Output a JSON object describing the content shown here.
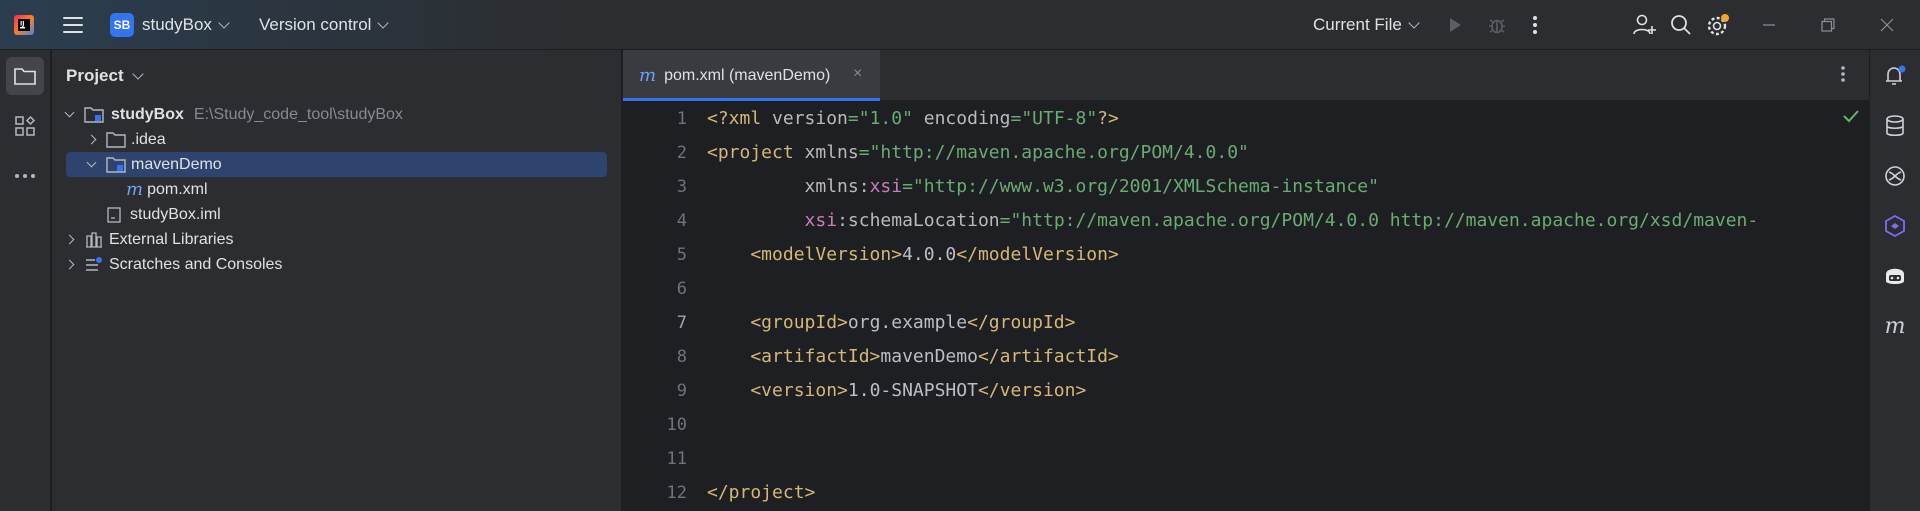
{
  "titlebar": {
    "project_badge": "SB",
    "project_name": "studyBox",
    "vcs_label": "Version control",
    "run_config": "Current File"
  },
  "project_panel": {
    "title": "Project",
    "tree": [
      {
        "label": "studyBox",
        "path": "E:\\Study_code_tool\\studyBox"
      },
      {
        "label": ".idea"
      },
      {
        "label": "mavenDemo"
      },
      {
        "label": "pom.xml"
      },
      {
        "label": "studyBox.iml"
      },
      {
        "label": "External Libraries"
      },
      {
        "label": "Scratches and Consoles"
      }
    ]
  },
  "editor": {
    "tab_icon": "m",
    "tab_label": "pom.xml (mavenDemo)",
    "tab_close": "×",
    "current_line": 7,
    "line_numbers": [
      "1",
      "2",
      "3",
      "4",
      "5",
      "6",
      "7",
      "8",
      "9",
      "10",
      "11",
      "12"
    ],
    "code": {
      "l1_a": "<?xml ",
      "l1_b": "version",
      "l1_c": "=",
      "l1_d": "\"1.0\"",
      "l1_e": " encoding",
      "l1_f": "=",
      "l1_g": "\"UTF-8\"",
      "l1_h": "?>",
      "l2_a": "<project ",
      "l2_b": "xmlns",
      "l2_c": "=",
      "l2_d": "\"http://maven.apache.org/POM/4.0.0\"",
      "l3_a": "         xmlns:",
      "l3_b": "xsi",
      "l3_c": "=",
      "l3_d": "\"http://www.w3.org/2001/XMLSchema-instance\"",
      "l4_a": "         ",
      "l4_b": "xsi",
      "l4_c": ":schemaLocation",
      "l4_d": "=",
      "l4_e": "\"http://maven.apache.org/POM/4.0.0 http://maven.apache.org/xsd/maven-",
      "l5_a": "    <modelVersion>",
      "l5_b": "4.0.0",
      "l5_c": "</modelVersion>",
      "l7_a": "    <groupId>",
      "l7_b": "org.example",
      "l7_c": "</groupId>",
      "l8_a": "    <artifactId>",
      "l8_b": "mavenDemo",
      "l8_c": "</artifactId>",
      "l9_a": "    <version>",
      "l9_b": "1.0-SNAPSHOT",
      "l9_c": "</version>",
      "l12_a": "</project>"
    }
  },
  "right_bar": {
    "maven_icon": "m"
  },
  "colors": {
    "accent": "#3574f0",
    "selection": "#2e436e",
    "tag": "#d5b778",
    "string": "#6aab73",
    "namespace": "#c77dbb"
  }
}
